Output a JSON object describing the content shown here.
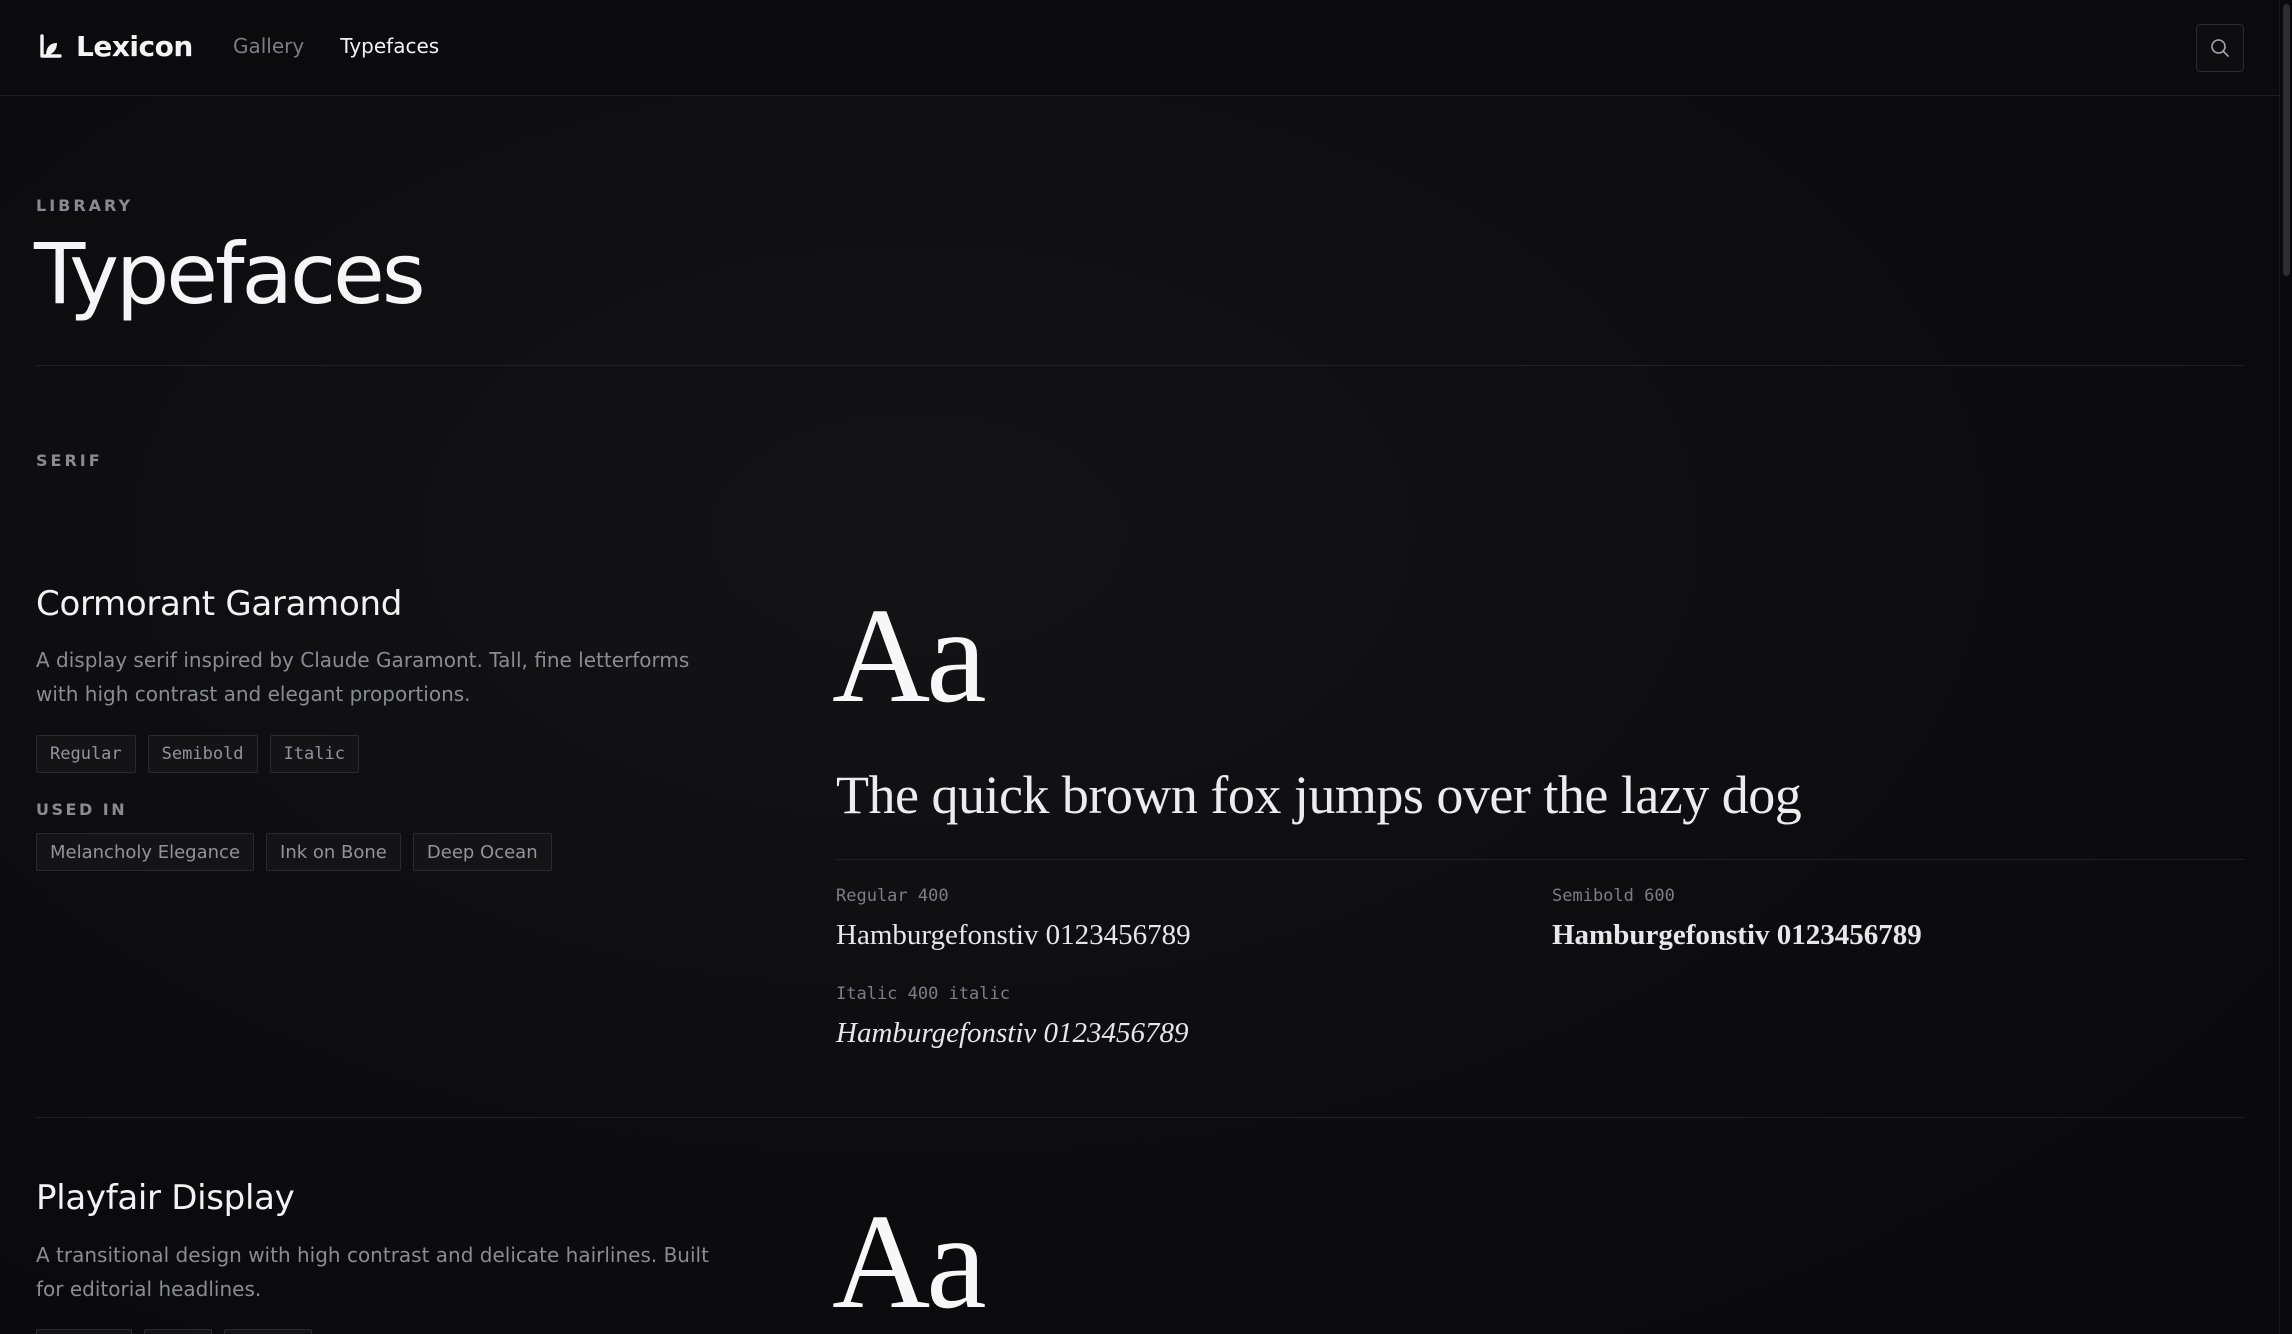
{
  "brand": {
    "name": "Lexicon"
  },
  "nav": {
    "gallery": "Gallery",
    "typefaces": "Typefaces"
  },
  "header": {
    "eyebrow": "LIBRARY",
    "title": "Typefaces"
  },
  "category": {
    "label": "SERIF"
  },
  "typefaces": [
    {
      "name": "Cormorant Garamond",
      "description": "A display serif inspired by Claude Garamont. Tall, fine letterforms with high contrast and elegant proportions.",
      "styles": [
        "Regular",
        "Semibold",
        "Italic"
      ],
      "used_in_label": "USED IN",
      "used_in": [
        "Melancholy Elegance",
        "Ink on Bone",
        "Deep Ocean"
      ],
      "specimen": "Aa",
      "pangram": "The quick brown fox jumps over the lazy dog",
      "weights": [
        {
          "label": "Regular 400",
          "sample": "Hamburgefonstiv 0123456789"
        },
        {
          "label": "Semibold 600",
          "sample": "Hamburgefonstiv 0123456789"
        },
        {
          "label": "Italic 400 italic",
          "sample": "Hamburgefonstiv 0123456789"
        }
      ]
    },
    {
      "name": "Playfair Display",
      "description": "A transitional design with high contrast and delicate hairlines. Built for editorial headlines.",
      "specimen": "Aa"
    }
  ],
  "icons": {
    "brand": "lexicon-logo-icon",
    "search": "search-icon"
  },
  "colors": {
    "background": "#0d0d0f",
    "text": "#f5f5f7",
    "muted": "#8b8b94",
    "border": "#2a2a30"
  }
}
